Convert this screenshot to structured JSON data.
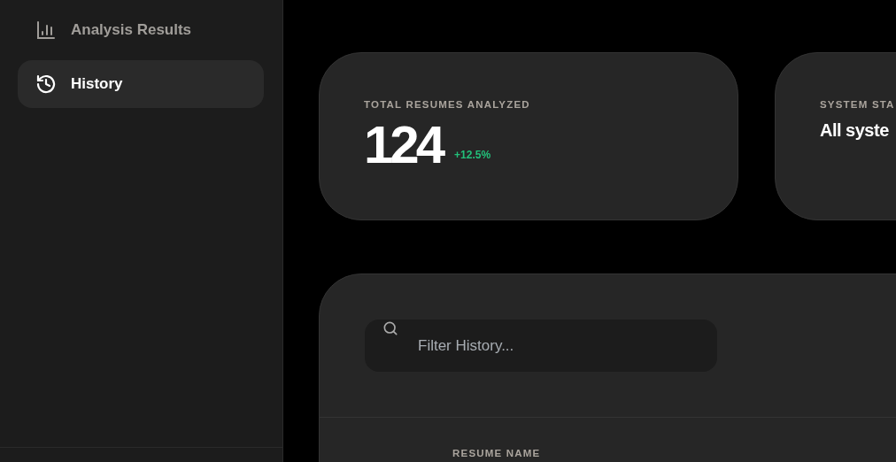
{
  "sidebar": {
    "items": [
      {
        "kind": "chart",
        "label": "Analysis Results",
        "selected": false
      },
      {
        "kind": "history",
        "label": "History",
        "selected": true
      }
    ]
  },
  "stats": [
    {
      "label": "TOTAL RESUMES ANALYZED",
      "value": "124",
      "change": "+12.5%"
    },
    {
      "label": "SYSTEM STA",
      "value": "All syste"
    }
  ],
  "history": {
    "filter": {
      "placeholder": "Filter History..."
    },
    "columns": [
      "RESUME NAME"
    ]
  }
}
